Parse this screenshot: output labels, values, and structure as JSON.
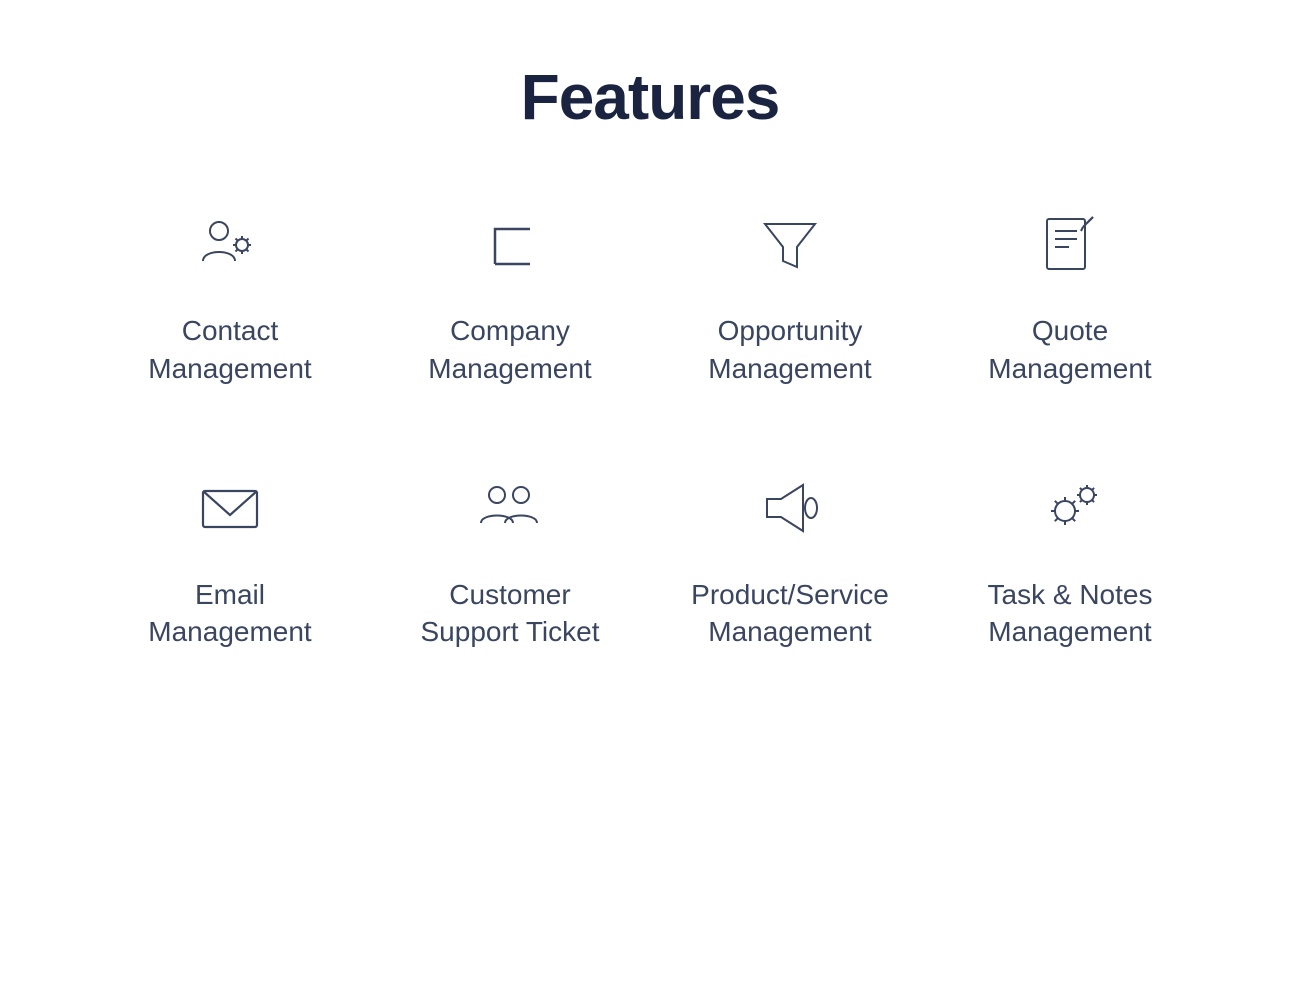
{
  "page": {
    "title": "Features"
  },
  "features": [
    {
      "id": "contact-management",
      "label": "Contact\nManagement",
      "icon": "contact-icon"
    },
    {
      "id": "company-management",
      "label": "Company\nManagement",
      "icon": "company-icon"
    },
    {
      "id": "opportunity-management",
      "label": "Opportunity\nManagement",
      "icon": "opportunity-icon"
    },
    {
      "id": "quote-management",
      "label": "Quote\nManagement",
      "icon": "quote-icon"
    },
    {
      "id": "email-management",
      "label": "Email\nManagement",
      "icon": "email-icon"
    },
    {
      "id": "customer-support-ticket",
      "label": "Customer\nSupport Ticket",
      "icon": "customer-icon"
    },
    {
      "id": "product-service-management",
      "label": "Product/Service\nManagement",
      "icon": "product-icon"
    },
    {
      "id": "task-notes-management",
      "label": "Task & Notes\nManagement",
      "icon": "task-icon"
    }
  ]
}
